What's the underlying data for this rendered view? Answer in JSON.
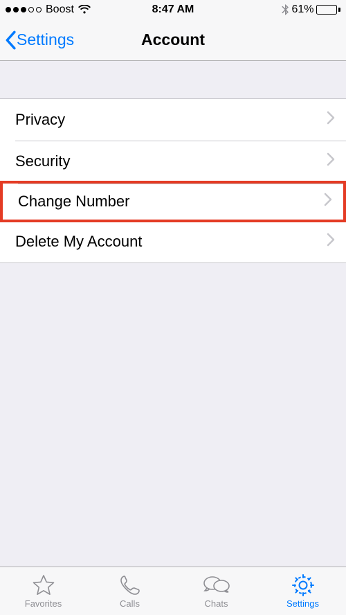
{
  "status": {
    "carrier": "Boost",
    "time": "8:47 AM",
    "battery_pct": "61%",
    "battery_fill": 61,
    "signal_filled": 3,
    "signal_total": 5
  },
  "nav": {
    "back_label": "Settings",
    "title": "Account"
  },
  "rows": {
    "privacy": "Privacy",
    "security": "Security",
    "change_number": "Change Number",
    "delete_account": "Delete My Account"
  },
  "tabs": {
    "favorites": "Favorites",
    "calls": "Calls",
    "chats": "Chats",
    "settings": "Settings"
  },
  "colors": {
    "tint": "#007aff",
    "highlight": "#e43b24"
  }
}
